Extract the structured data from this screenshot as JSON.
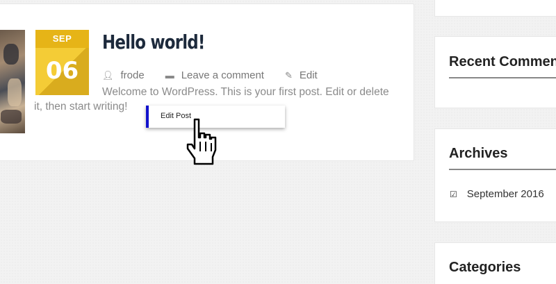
{
  "post": {
    "date": {
      "month": "SEP",
      "day": "06"
    },
    "title": "Hello world!",
    "meta": {
      "author": "frode",
      "comment_link": "Leave a comment",
      "edit_link": "Edit"
    },
    "excerpt": "Welcome to WordPress. This is your first post. Edit or delete it, then start writing!"
  },
  "tooltip": {
    "label": "Edit Post"
  },
  "sidebar": {
    "widgets": [
      {
        "title": "Recent Comments"
      },
      {
        "title": "Archives",
        "items": [
          {
            "label": "September 2016"
          }
        ]
      },
      {
        "title": "Categories"
      }
    ]
  },
  "icons": {
    "author": "user-icon",
    "comment": "comment-icon",
    "edit": "edit-icon",
    "archive_item": "checkbox-icon",
    "cursor": "hand-cursor-icon"
  },
  "colors": {
    "date_month_bg": "#e6b417",
    "date_day_bg": "#f4cc36",
    "title": "#1d2a3c",
    "tooltip_accent": "#1111cc"
  }
}
